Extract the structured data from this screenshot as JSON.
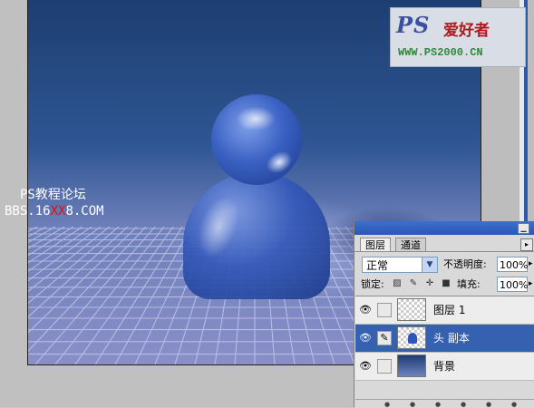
{
  "canvas": {
    "watermark_forum": {
      "title": "PS教程论坛",
      "url_prefix": "BBS.16",
      "url_red": "XX",
      "url_suffix": "8.COM"
    },
    "watermark_logo": {
      "brand": "PS",
      "cn": "爱好者",
      "url": "WWW.PS2000.CN"
    }
  },
  "layers_panel": {
    "minimize_glyph": "▁",
    "tabs": [
      {
        "label": "图层",
        "active": true
      },
      {
        "label": "通道",
        "active": false
      }
    ],
    "menu_glyph": "▸",
    "blend_mode": "正常",
    "dropdown_glyph": "▼",
    "opacity_label": "不透明度:",
    "opacity_value": "100%",
    "spin_glyph": "▸",
    "lock_label": "锁定:",
    "lock_icons": [
      "checker-lock-icon",
      "brush-lock-icon",
      "move-lock-icon",
      "padlock-icon"
    ],
    "fill_label": "填充:",
    "fill_value": "100%",
    "layers": [
      {
        "name": "图层 1",
        "visible_glyph": "👁",
        "thumb": "transparent",
        "selected": false
      },
      {
        "name": "头 副本",
        "visible_glyph": "👁",
        "link_glyph": "✎",
        "thumb": "figure",
        "selected": true
      },
      {
        "name": "背景",
        "visible_glyph": "👁",
        "thumb": "background",
        "selected": false
      }
    ]
  }
}
